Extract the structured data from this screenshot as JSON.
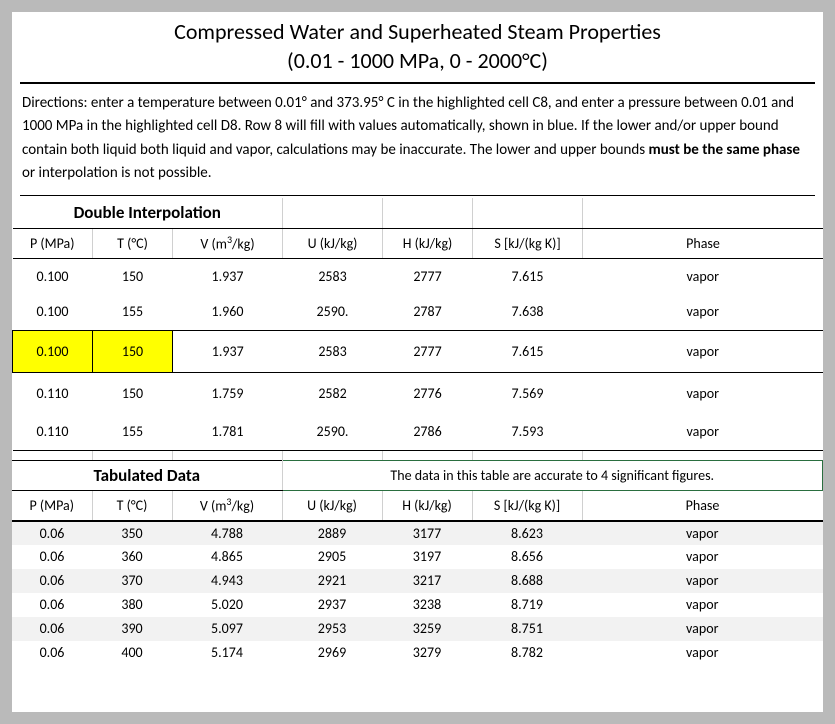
{
  "title": "Compressed Water and Superheated Steam Properties",
  "subtitle": "(0.01 - 1000 MPa, 0 - 2000°C)",
  "directions_pre": "Directions: enter a temperature between 0.01° and 373.95° C in the highlighted cell C8, and enter a pressure between 0.01 and 1000 MPa in the highlighted cell D8. Row 8 will fill with values automatically, shown in blue. If the lower and/or upper bound contain both liquid both liquid and vapor, calculations may be inaccurate. The lower and upper bounds ",
  "directions_bold": "must be the same phase",
  "directions_post": " or interpolation is not possible.",
  "interp_section": "Double Interpolation",
  "headers": {
    "p": "P (MPa)",
    "t": "T (°C)",
    "v_pre": "V (m",
    "v_sup": "3",
    "v_post": "/kg)",
    "u": "U (kJ/kg)",
    "h": "H (kJ/kg)",
    "s": "S [kJ/(kg K)]",
    "phase": "Phase"
  },
  "interp_rows": [
    {
      "p": "0.100",
      "t": "150",
      "v": "1.937",
      "u": "2583",
      "h": "2777",
      "s": "7.615",
      "phase": "vapor"
    },
    {
      "p": "0.100",
      "t": "155",
      "v": "1.960",
      "u": "2590.",
      "h": "2787",
      "s": "7.638",
      "phase": "vapor"
    },
    {
      "p": "0.100",
      "t": "150",
      "v": "1.937",
      "u": "2583",
      "h": "2777",
      "s": "7.615",
      "phase": "vapor"
    },
    {
      "p": "0.110",
      "t": "150",
      "v": "1.759",
      "u": "2582",
      "h": "2776",
      "s": "7.569",
      "phase": "vapor"
    },
    {
      "p": "0.110",
      "t": "155",
      "v": "1.781",
      "u": "2590.",
      "h": "2786",
      "s": "7.593",
      "phase": "vapor"
    }
  ],
  "tab_section": "Tabulated Data",
  "tab_note": "The data in this table are accurate to 4 significant figures.",
  "tab_rows": [
    {
      "p": "0.06",
      "t": "350",
      "v": "4.788",
      "u": "2889",
      "h": "3177",
      "s": "8.623",
      "phase": "vapor"
    },
    {
      "p": "0.06",
      "t": "360",
      "v": "4.865",
      "u": "2905",
      "h": "3197",
      "s": "8.656",
      "phase": "vapor"
    },
    {
      "p": "0.06",
      "t": "370",
      "v": "4.943",
      "u": "2921",
      "h": "3217",
      "s": "8.688",
      "phase": "vapor"
    },
    {
      "p": "0.06",
      "t": "380",
      "v": "5.020",
      "u": "2937",
      "h": "3238",
      "s": "8.719",
      "phase": "vapor"
    },
    {
      "p": "0.06",
      "t": "390",
      "v": "5.097",
      "u": "2953",
      "h": "3259",
      "s": "8.751",
      "phase": "vapor"
    },
    {
      "p": "0.06",
      "t": "400",
      "v": "5.174",
      "u": "2969",
      "h": "3279",
      "s": "8.782",
      "phase": "vapor"
    }
  ]
}
